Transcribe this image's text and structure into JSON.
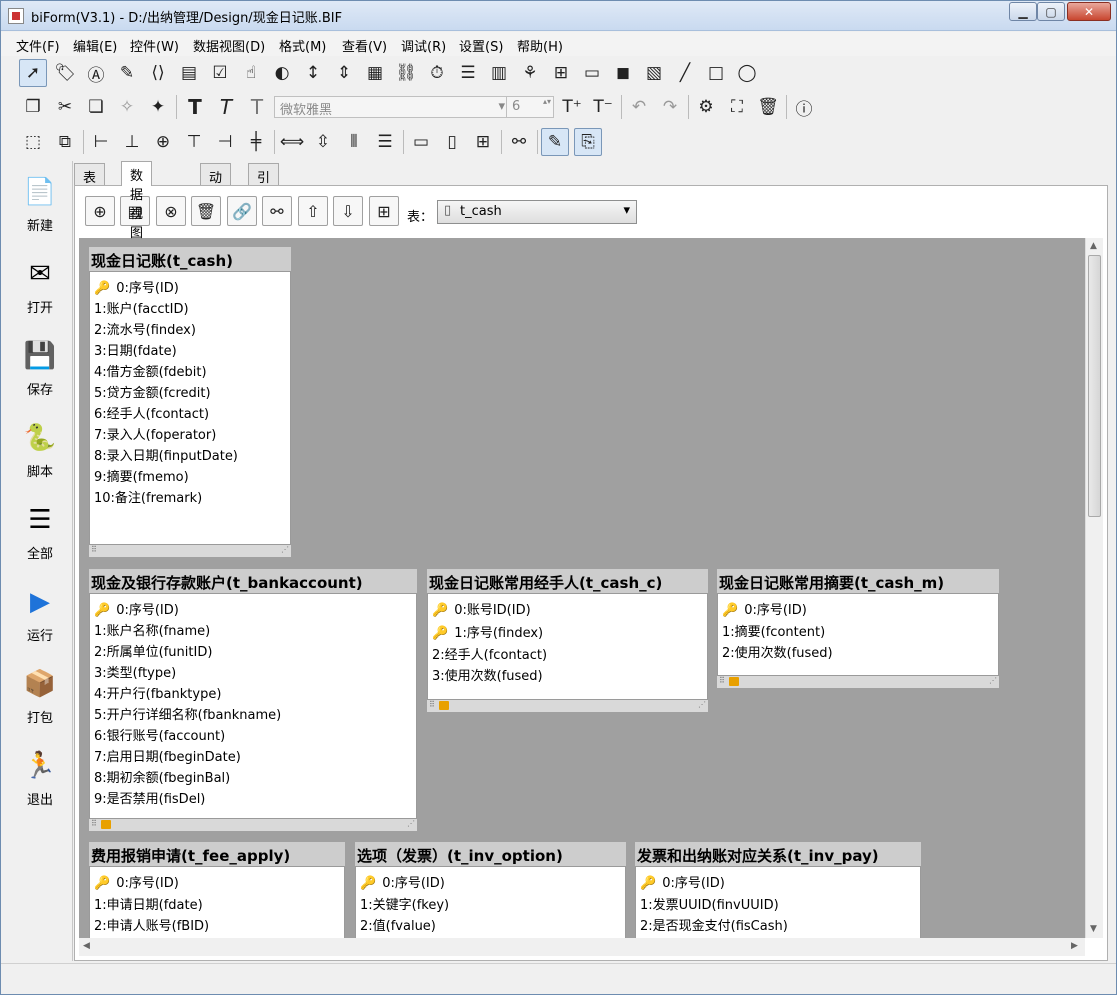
{
  "window": {
    "title": "biForm(V3.1) - D:/出纳管理/Design/现金日记账.BIF",
    "min_label": "▁",
    "max_label": "▢",
    "close_label": "✕"
  },
  "menu": [
    "文件(F)",
    "编辑(E)",
    "控件(W)",
    "数据视图(D)",
    "格式(M)",
    "查看(V)",
    "调试(R)",
    "设置(S)",
    "帮助(H)"
  ],
  "font_toolbar": {
    "font_name": "微软雅黑",
    "font_size": "6"
  },
  "sidebar": [
    {
      "label": "新建",
      "icon": "new-icon"
    },
    {
      "label": "打开",
      "icon": "open-icon"
    },
    {
      "label": "保存",
      "icon": "save-icon"
    },
    {
      "label": "脚本",
      "icon": "script-icon"
    },
    {
      "label": "全部",
      "icon": "all-icon"
    },
    {
      "label": "运行",
      "icon": "run-icon"
    },
    {
      "label": "打包",
      "icon": "package-icon"
    },
    {
      "label": "退出",
      "icon": "exit-icon"
    }
  ],
  "tabs": [
    "表单",
    "数据视图",
    "动作",
    "引用列表"
  ],
  "table_picker": {
    "label": "表：",
    "value": "t_cash"
  },
  "entities": [
    {
      "title": "现金日记账(t_cash)",
      "fields": [
        "0:序号(ID)",
        "1:账户(facctID)",
        "2:流水号(findex)",
        "3:日期(fdate)",
        "4:借方金额(fdebit)",
        "5:贷方金额(fcredit)",
        "6:经手人(fcontact)",
        "7:录入人(foperator)",
        "8:录入日期(finputDate)",
        "9:摘要(fmemo)",
        "10:备注(fremark)"
      ]
    },
    {
      "title": "现金及银行存款账户(t_bankaccount)",
      "fields": [
        "0:序号(ID)",
        "1:账户名称(fname)",
        "2:所属单位(funitID)",
        "3:类型(ftype)",
        "4:开户行(fbanktype)",
        "5:开户行详细名称(fbankname)",
        "6:银行账号(faccount)",
        "7:启用日期(fbeginDate)",
        "8:期初余额(fbeginBal)",
        "9:是否禁用(fisDel)"
      ]
    },
    {
      "title": "现金日记账常用经手人(t_cash_c)",
      "fields": [
        "0:账号ID(ID)",
        "1:序号(findex)",
        "2:经手人(fcontact)",
        "3:使用次数(fused)"
      ]
    },
    {
      "title": "现金日记账常用摘要(t_cash_m)",
      "fields": [
        "0:序号(ID)",
        "1:摘要(fcontent)",
        "2:使用次数(fused)"
      ]
    },
    {
      "title": "费用报销申请(t_fee_apply)",
      "fields": [
        "0:序号(ID)",
        "1:申请日期(fdate)",
        "2:申请人账号(fBID)"
      ]
    },
    {
      "title": "选项（发票）(t_inv_option)",
      "fields": [
        "0:序号(ID)",
        "1:关键字(fkey)",
        "2:值(fvalue)"
      ]
    },
    {
      "title": "发票和出纳账对应关系(t_inv_pay)",
      "fields": [
        "0:序号(ID)",
        "1:发票UUID(finvUUID)",
        "2:是否现金支付(fisCash)"
      ]
    }
  ]
}
